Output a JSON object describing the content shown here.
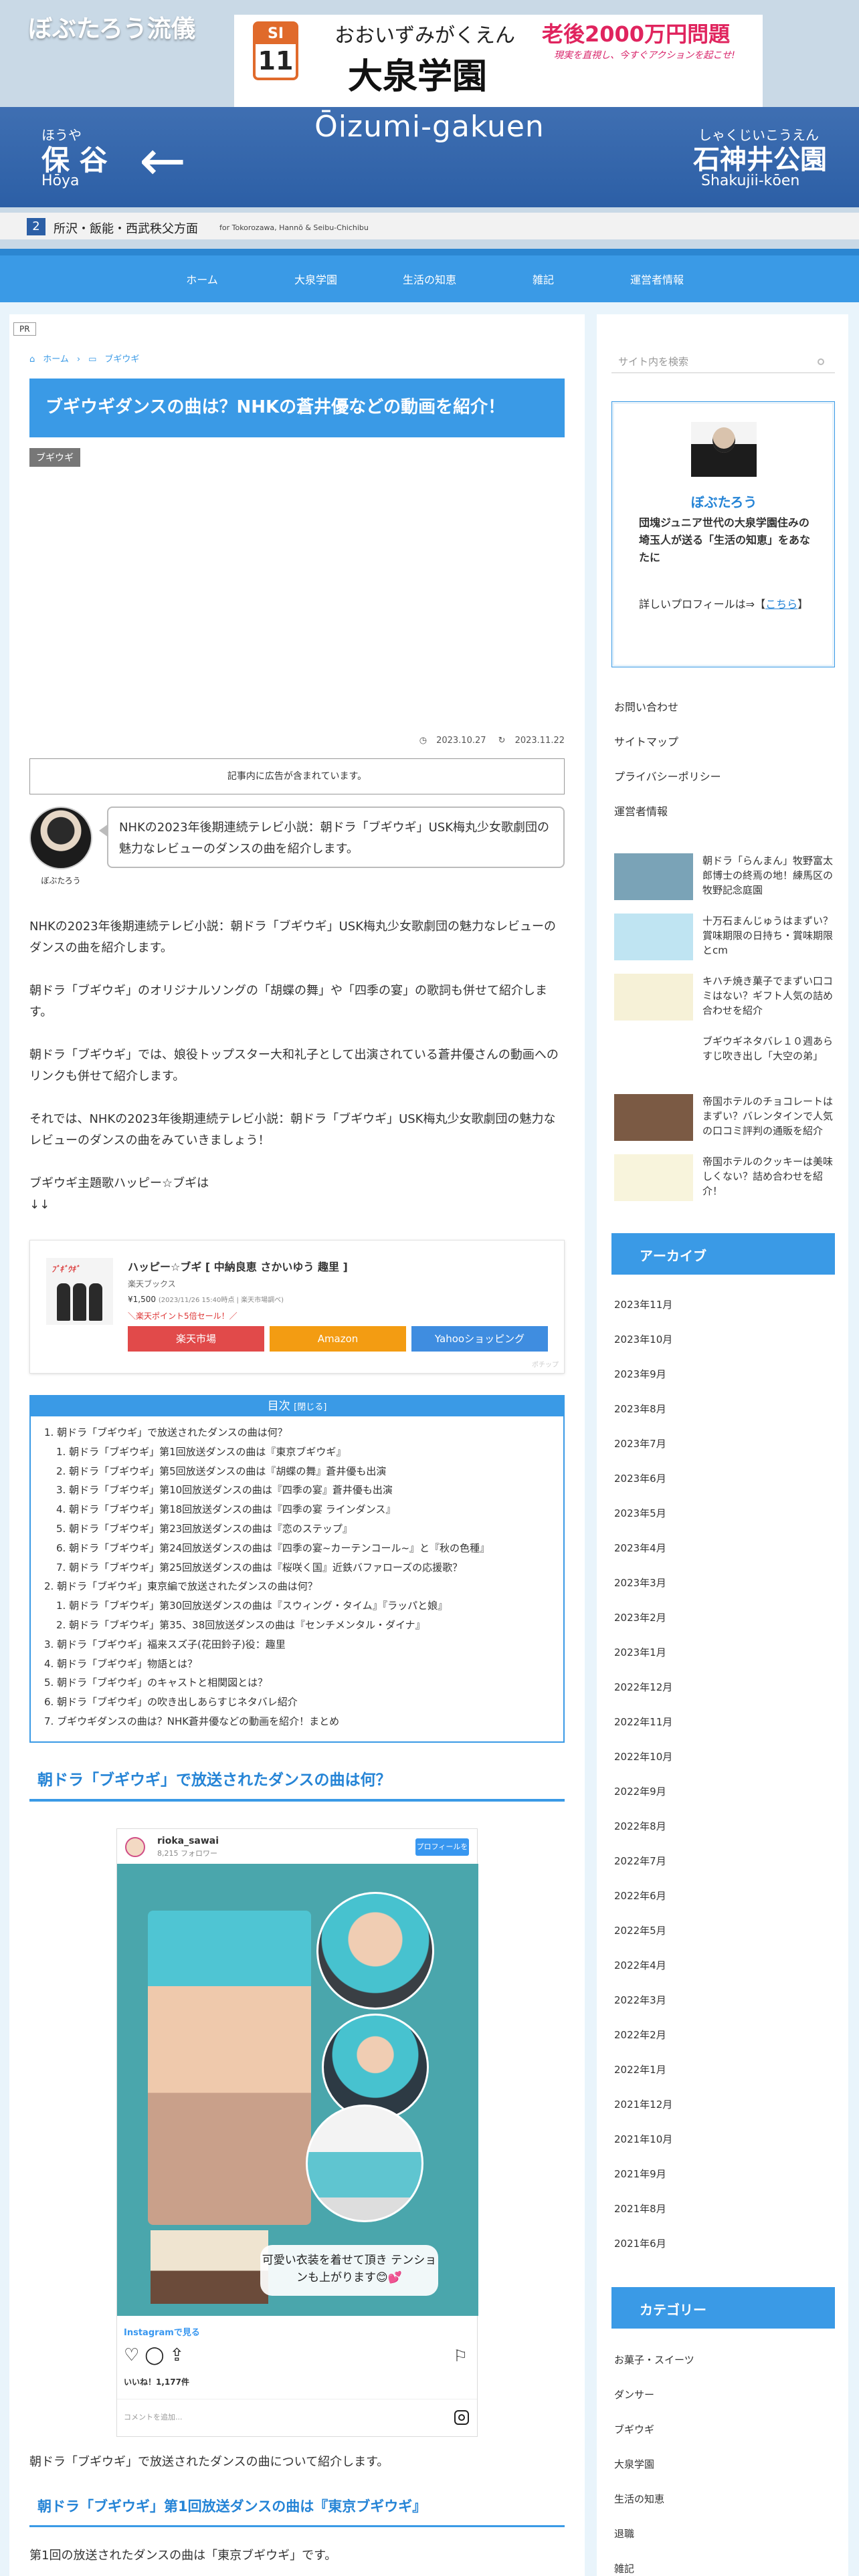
{
  "site": {
    "title": "ぼぶたろう流儀"
  },
  "header_image": {
    "station_code": "SI",
    "station_number": "11",
    "name_kana": "おおいずみがくえん",
    "ad_text": "老後2000万円問題",
    "ad_sub": "現実を直視し、今すぐアクションを起こせ!",
    "name": "大泉学園",
    "name_roman": "Ōizumi-gakuen",
    "left_kana": "ほうや",
    "left_name": "保 谷",
    "left_roman": "Hōya",
    "right_kana": "しゃくじいこうえん",
    "right_name": "石神井公園",
    "right_roman": "Shakujii-kōen",
    "line_number": "2",
    "line_text": "所沢・飯能・西武秩父方面",
    "line_sub": "for Tokorozawa, Hannō & Seibu-Chichibu"
  },
  "nav": {
    "items": [
      "ホーム",
      "大泉学園",
      "生活の知恵",
      "雑記",
      "運営者情報"
    ]
  },
  "article": {
    "pr": "PR",
    "breadcrumb": {
      "home": "ホーム",
      "category": "ブギウギ"
    },
    "title": "ブギウギダンスの曲は？NHKの蒼井優などの動画を紹介！",
    "category_tag": "ブギウギ",
    "published": "2023.10.27",
    "updated": "2023.11.22",
    "ad_notice": "記事内に広告が含まれています。",
    "author_name": "ぼぶたろう",
    "balloon_text": "NHKの2023年後期連続テレビ小説：朝ドラ「ブギウギ」USK梅丸少女歌劇団の魅力なレビューのダンスの曲を紹介します。",
    "paragraphs": [
      "NHKの2023年後期連続テレビ小説：朝ドラ「ブギウギ」USK梅丸少女歌劇団の魅力なレビューのダンスの曲を紹介します。",
      "朝ドラ「ブギウギ」のオリジナルソングの「胡蝶の舞」や「四季の宴」の歌詞も併せて紹介します。",
      "朝ドラ「ブギウギ」では、娘役トップスター大和礼子として出演されている蒼井優さんの動画へのリンクも併せて紹介します。",
      "それでは、NHKの2023年後期連続テレビ小説：朝ドラ「ブギウギ」USK梅丸少女歌劇団の魅力なレビューのダンスの曲をみていきましょう！",
      "ブギウギ主題歌ハッピー☆ブギは",
      "↓↓"
    ],
    "product": {
      "title": "ハッピー☆ブギ [ 中納良恵 さかいゆう 趣里 ]",
      "shop": "楽天ブックス",
      "price": "¥1,500",
      "price_note": "(2023/11/26 15:40時点 | 楽天市場調べ)",
      "sale": "＼楽天ポイント5倍セール！／",
      "buttons": [
        "楽天市場",
        "Amazon",
        "Yahooショッピング"
      ],
      "colors": [
        "#e14a4a",
        "#f39c12",
        "#3f8de0"
      ],
      "footer": "ポチップ"
    },
    "toc": {
      "title": "目次",
      "toggle": "[閉じる]",
      "items": [
        {
          "text": "1. 朝ドラ「ブギウギ」で放送されたダンスの曲は何？",
          "sub": false
        },
        {
          "text": "1. 朝ドラ「ブギウギ」第1回放送ダンスの曲は『東京ブギウギ』",
          "sub": true
        },
        {
          "text": "2. 朝ドラ「ブギウギ」第5回放送ダンスの曲は『胡蝶の舞』蒼井優も出演",
          "sub": true
        },
        {
          "text": "3. 朝ドラ「ブギウギ」第10回放送ダンスの曲は『四季の宴』蒼井優も出演",
          "sub": true
        },
        {
          "text": "4. 朝ドラ「ブギウギ」第18回放送ダンスの曲は『四季の宴 ラインダンス』",
          "sub": true
        },
        {
          "text": "5. 朝ドラ「ブギウギ」第23回放送ダンスの曲は『恋のステップ』",
          "sub": true
        },
        {
          "text": "6. 朝ドラ「ブギウギ」第24回放送ダンスの曲は『四季の宴~カーテンコール~』と『秋の色種』",
          "sub": true
        },
        {
          "text": "7. 朝ドラ「ブギウギ」第25回放送ダンスの曲は『桜咲く国』近鉄バファローズの応援歌？",
          "sub": true
        },
        {
          "text": "2. 朝ドラ「ブギウギ」東京編で放送されたダンスの曲は何？",
          "sub": false
        },
        {
          "text": "1. 朝ドラ「ブギウギ」第30回放送ダンスの曲は『スウィング・タイム』『ラッパと娘』",
          "sub": true
        },
        {
          "text": "2. 朝ドラ「ブギウギ」第35、38回放送ダンスの曲は『センチメンタル・ダイナ』",
          "sub": true
        },
        {
          "text": "3. 朝ドラ「ブギウギ」福来スズ子(花田鈴子)役：趣里",
          "sub": false
        },
        {
          "text": "4. 朝ドラ「ブギウギ」物語とは？",
          "sub": false
        },
        {
          "text": "5. 朝ドラ「ブギウギ」のキャストと相関図とは？",
          "sub": false
        },
        {
          "text": "6. 朝ドラ「ブギウギ」の吹き出しあらすじネタバレ紹介",
          "sub": false
        },
        {
          "text": "7. ブギウギダンスの曲は？NHK蒼井優などの動画を紹介！まとめ",
          "sub": false
        }
      ]
    },
    "h2_1": "朝ドラ「ブギウギ」で放送されたダンスの曲は何？",
    "instagram": {
      "user": "rioka_sawai",
      "followers": "8,215 フォロワー",
      "follow_btn": "プロフィールを見る",
      "caption": "可愛い衣装を着せて頂き テンションも上がります😊💕",
      "link": "Instagramで見る",
      "likes": "いいね！1,177件",
      "comment_hint": "コメントを追加..."
    },
    "after_insta": "朝ドラ「ブギウギ」で放送されたダンスの曲について紹介します。",
    "h3_1": "朝ドラ「ブギウギ」第1回放送ダンスの曲は『東京ブギウギ』",
    "last_para": "第1回の放送されたダンスの曲は「東京ブギウギ」です。"
  },
  "sidebar": {
    "search_placeholder": "サイト内を検索",
    "profile": {
      "name": "ぼぶたろう",
      "description": "団塊ジュニア世代の大泉学園住みの埼玉人が送る「生活の知恵」をあなたに",
      "more_prefix": "詳しいプロフィールは⇒【",
      "more_link": "こちら",
      "more_suffix": "】"
    },
    "links": [
      "お問い合わせ",
      "サイトマップ",
      "プライバシーポリシー",
      "運営者情報"
    ],
    "related": [
      {
        "title": "朝ドラ「らんまん」牧野富太郎博士の終焉の地！練馬区の牧野記念庭園",
        "thumb": "#7aa3b7"
      },
      {
        "title": "十万石まんじゅうはまずい？賞味期限の日持ち・賞味期限とcm",
        "thumb": "#bfe4f2"
      },
      {
        "title": "キハチ焼き菓子でまずい口コミはない？ギフト人気の詰め合わせを紹介",
        "thumb": "#f6f1d7"
      },
      {
        "title": "ブギウギネタバレ１０週あらすじ吹き出し「大空の弟」",
        "thumb": "#ffffff"
      },
      {
        "title": "帝国ホテルのチョコレートはまずい？バレンタインで人気の口コミ評判の通販を紹介",
        "thumb": "#7b5a44"
      },
      {
        "title": "帝国ホテルのクッキーは美味しくない？詰め合わせを紹介！",
        "thumb": "#f8f4dc"
      }
    ],
    "archive_title": "アーカイブ",
    "archives": [
      "2023年11月",
      "2023年10月",
      "2023年9月",
      "2023年8月",
      "2023年7月",
      "2023年6月",
      "2023年5月",
      "2023年4月",
      "2023年3月",
      "2023年2月",
      "2023年1月",
      "2022年12月",
      "2022年11月",
      "2022年10月",
      "2022年9月",
      "2022年8月",
      "2022年7月",
      "2022年6月",
      "2022年5月",
      "2022年4月",
      "2022年3月",
      "2022年2月",
      "2022年1月",
      "2021年12月",
      "2021年10月",
      "2021年9月",
      "2021年8月",
      "2021年6月"
    ],
    "category_title": "カテゴリー",
    "categories": [
      "お菓子・スイーツ",
      "ダンサー",
      "ブギウギ",
      "大泉学園",
      "生活の知恵",
      "退職",
      "雑記"
    ]
  }
}
